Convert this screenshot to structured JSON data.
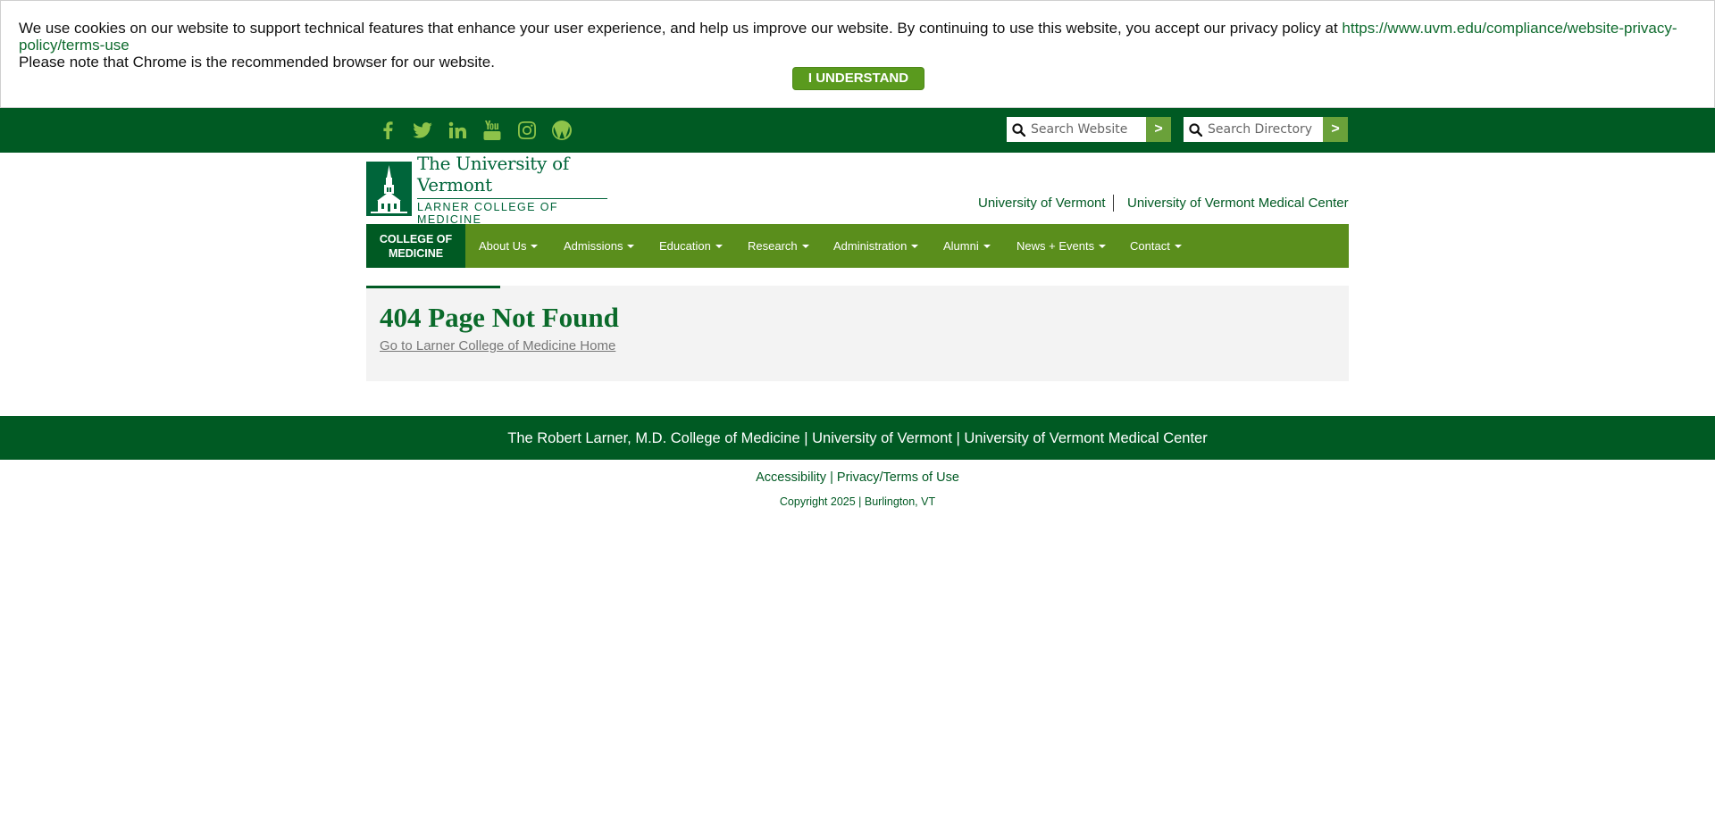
{
  "cookie_banner": {
    "text_before_link": "We use cookies on our website to support technical features that enhance your user experience, and help us improve our website. By continuing to use this website, you accept our privacy policy at ",
    "policy_link": "https://www.uvm.edu/compliance/website-privacy-policy/terms-use",
    "text_second_line": "Please note that Chrome is the recommended browser for our website.",
    "accept_button": "I UNDERSTAND"
  },
  "topbar": {
    "social_icons": [
      "facebook-icon",
      "twitter-icon",
      "linkedin-icon",
      "youtube-icon",
      "instagram-icon",
      "wordpress-icon"
    ],
    "search_website": {
      "placeholder": "Search Website",
      "button": ">"
    },
    "search_directory": {
      "placeholder": "Search Directory",
      "button": ">"
    }
  },
  "header": {
    "logo_title": "The University of Vermont",
    "logo_subtitle": "LARNER COLLEGE OF MEDICINE",
    "links": [
      "University of Vermont",
      "University of Vermont Medical Center"
    ]
  },
  "nav": {
    "home_label": "COLLEGE OF MEDICINE",
    "items": [
      "About Us",
      "Admissions",
      "Education",
      "Research",
      "Administration",
      "Alumni",
      "News + Events",
      "Contact"
    ]
  },
  "main": {
    "title": "404 Page Not Found",
    "home_link": "Go to Larner College of Medicine Home"
  },
  "footer": {
    "bar_text": "The Robert Larner, M.D. College of Medicine | University of Vermont | University of Vermont Medical Center",
    "accessibility": "Accessibility",
    "separator": "|",
    "privacy": "Privacy/Terms of Use",
    "copyright": "Copyright 2025 | Burlington, VT"
  },
  "colors": {
    "dark_green": "#005a23",
    "nav_green": "#5a8e1c",
    "accent_green": "#8dc34a",
    "button_green": "#5a9a1e"
  }
}
